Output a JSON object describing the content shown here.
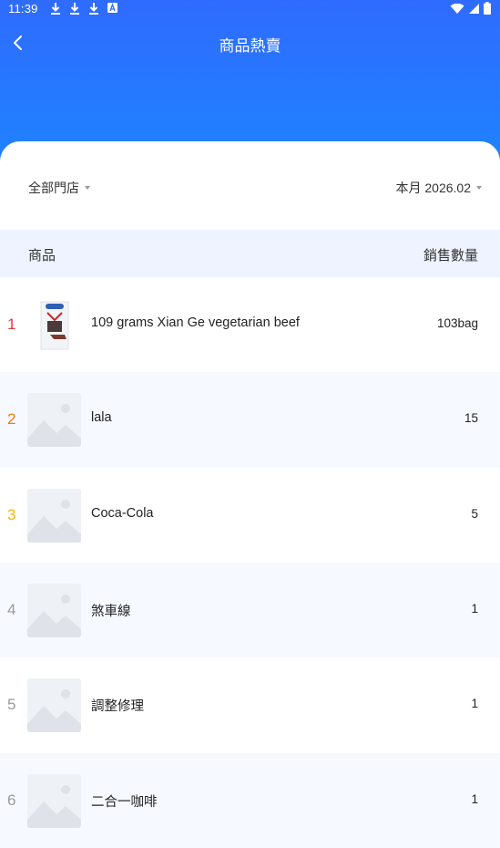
{
  "status": {
    "time": "11:39"
  },
  "header": {
    "title": "商品熱賣"
  },
  "filters": {
    "store": "全部門店",
    "month": "本月 2026.02"
  },
  "table": {
    "col_product": "商品",
    "col_sales": "銷售數量",
    "rows": [
      {
        "rank": "1",
        "name": "109 grams Xian Ge vegetarian beef",
        "qty": "103bag",
        "rank_color": "#e53935",
        "has_photo": true
      },
      {
        "rank": "2",
        "name": "lala",
        "qty": "15",
        "rank_color": "#f57c00",
        "has_photo": false
      },
      {
        "rank": "3",
        "name": "Coca-Cola",
        "qty": "5",
        "rank_color": "#f9b500",
        "has_photo": false
      },
      {
        "rank": "4",
        "name": "煞車線",
        "qty": "1",
        "rank_color": "#9a9a9a",
        "has_photo": false
      },
      {
        "rank": "5",
        "name": "調整修理",
        "qty": "1",
        "rank_color": "#9a9a9a",
        "has_photo": false
      },
      {
        "rank": "6",
        "name": "二合一咖啡",
        "qty": "1",
        "rank_color": "#9a9a9a",
        "has_photo": false
      }
    ]
  }
}
